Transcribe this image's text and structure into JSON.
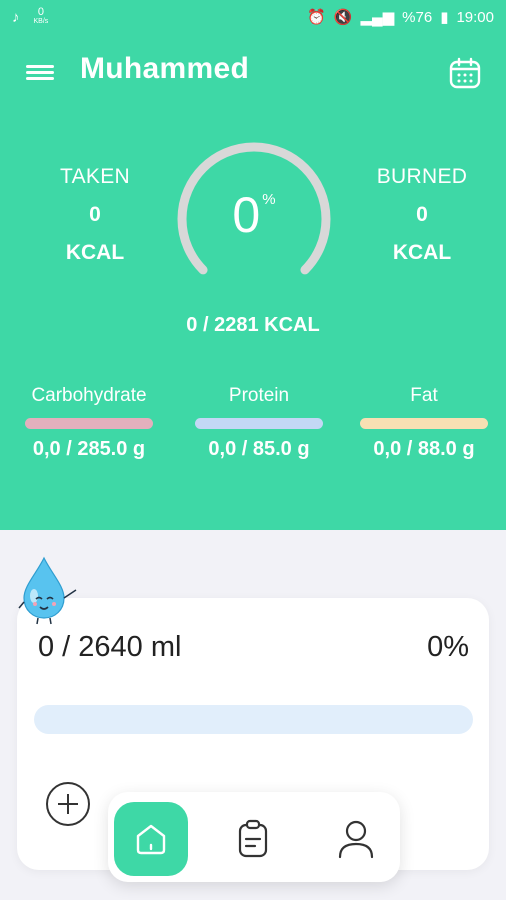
{
  "status_bar": {
    "speed_value": "0",
    "speed_unit": "KB/s",
    "battery": "%76",
    "time": "19:00"
  },
  "header": {
    "title": "Muhammed",
    "icons": [
      "menu-icon",
      "calendar-icon"
    ]
  },
  "calories": {
    "taken_label": "TAKEN",
    "taken_value": "0",
    "taken_unit": "KCAL",
    "burned_label": "BURNED",
    "burned_value": "0",
    "burned_unit": "KCAL",
    "percent_value": "0",
    "percent_sign": "%",
    "progress_fraction": 0,
    "total": "0 / 2281 KCAL"
  },
  "macros": [
    {
      "name": "Carbohydrate",
      "value": "0,0 / 285.0 g",
      "color": "#e3b0bd"
    },
    {
      "name": "Protein",
      "value": "0,0 / 85.0 g",
      "color": "#c3d8f5"
    },
    {
      "name": "Fat",
      "value": "0,0 / 88.0 g",
      "color": "#f7e0b3"
    }
  ],
  "water": {
    "amount": "0 / 2640 ml",
    "percent": "0%",
    "progress_fraction": 0
  },
  "nav": {
    "items": [
      "home-icon",
      "clipboard-icon",
      "user-icon"
    ],
    "active": "home"
  },
  "colors": {
    "accent": "#3ed8a6",
    "background": "#f2f2f7",
    "gauge_track": "#d8d8d8"
  }
}
